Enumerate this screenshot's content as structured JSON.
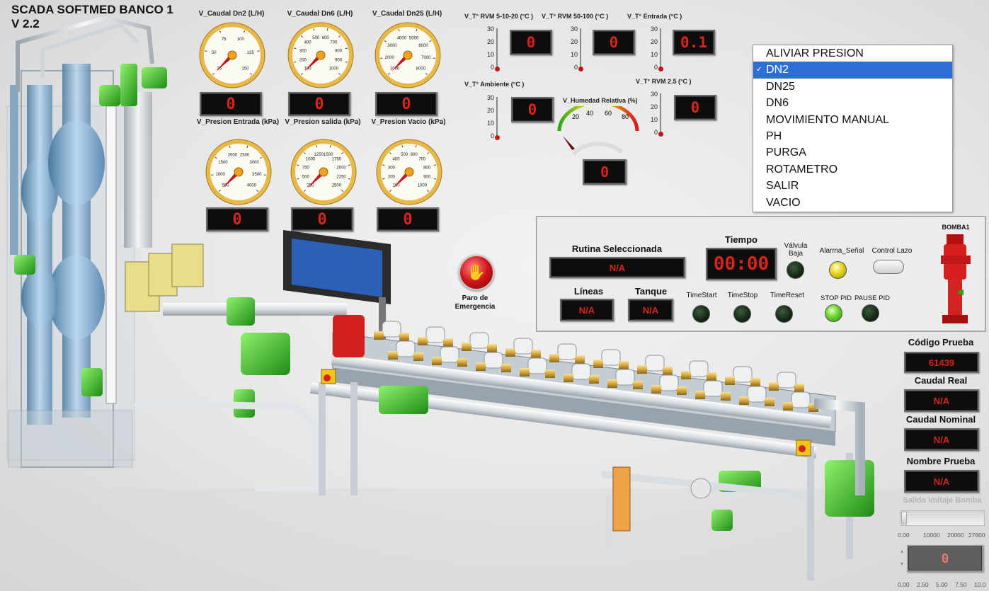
{
  "app": {
    "title_line1": "SCADA SOFTMED BANCO 1",
    "title_line2": "V 2.2"
  },
  "flow_gauges": [
    {
      "label": "V_Caudal Dn2 (L/H)",
      "ticks": [
        "25",
        "50",
        "75",
        "100",
        "125",
        "150"
      ],
      "value": 0,
      "display": "0"
    },
    {
      "label": "V_Caudal Dn6 (L/H)",
      "ticks": [
        "100",
        "200",
        "300",
        "400",
        "500",
        "600",
        "700",
        "800",
        "900",
        "1000"
      ],
      "value": 0,
      "display": "0"
    },
    {
      "label": "V_Caudal Dn25 (L/H)",
      "ticks": [
        "1000",
        "2000",
        "3000",
        "4000",
        "5000",
        "6000",
        "7000",
        "8000"
      ],
      "value": 0,
      "display": "0"
    }
  ],
  "pressure_gauges": [
    {
      "label": "V_Presion Entrada (kPa)",
      "ticks": [
        "500",
        "1000",
        "1500",
        "2000",
        "2500",
        "3000",
        "3500",
        "4000"
      ],
      "value": 0,
      "display": "0"
    },
    {
      "label": "V_Presion salida (kPa)",
      "ticks": [
        "250",
        "500",
        "750",
        "1000",
        "1250",
        "1500",
        "1750",
        "2000",
        "2250",
        "2500"
      ],
      "value": 0,
      "display": "0"
    },
    {
      "label": "V_Presion Vacio (kPa)",
      "ticks": [
        "100",
        "200",
        "300",
        "400",
        "500",
        "600",
        "700",
        "800",
        "900",
        "1000"
      ],
      "value": 0,
      "display": "0"
    }
  ],
  "thermometers": [
    {
      "label": "V_T° RVM 5-10-20 (°C )",
      "scale": [
        "30",
        "20",
        "10",
        "0"
      ],
      "display": "0"
    },
    {
      "label": "V_T° RVM 50-100 (°C )",
      "scale": [
        "30",
        "20",
        "10",
        "0"
      ],
      "display": "0"
    },
    {
      "label": "V_T° Entrada (°C )",
      "scale": [
        "30",
        "20",
        "10",
        "0"
      ],
      "display": "0.1"
    },
    {
      "label": "V_T° Ambiente (°C )",
      "scale": [
        "30",
        "20",
        "10",
        "0"
      ],
      "display": "0"
    },
    {
      "label": "V_T° RVM 2.5 (°C )",
      "scale": [
        "30",
        "20",
        "10",
        "0"
      ],
      "display": "0"
    }
  ],
  "humidity": {
    "label": "V_Humedad Relativa (%)",
    "ticks": [
      "20",
      "40",
      "60",
      "80"
    ],
    "display": "0"
  },
  "routine_menu": {
    "items": [
      "ALIVIAR PRESION",
      "DN2",
      "DN25",
      "DN6",
      "MOVIMIENTO MANUAL",
      "PH",
      "PURGA",
      "ROTAMETRO",
      "SALIR",
      "VACIO"
    ],
    "selected": "DN2"
  },
  "emergency": {
    "label_line1": "Paro de",
    "label_line2": "Emergencia"
  },
  "panel": {
    "rutina_label": "Rutina Seleccionada",
    "rutina_value": "N/A",
    "tiempo_label": "Tiempo",
    "tiempo_value": "00:00",
    "lineas_label": "Líneas",
    "lineas_value": "N/A",
    "tanque_label": "Tanque",
    "tanque_value": "N/A",
    "valvula_label_1": "Válvula",
    "valvula_label_2": "Baja",
    "alarma_label": "Alarma_Señal",
    "control_lazo_label": "Control Lazo",
    "timestart_label": "TimeStart",
    "timestop_label": "TimeStop",
    "timereset_label": "TimeReset",
    "stop_pid_label": "STOP PID",
    "pause_pid_label": "PAUSE PID",
    "bomba_label": "BOMBA1"
  },
  "info": {
    "codigo_label": "Código Prueba",
    "codigo_value": "61439",
    "caudal_real_label": "Caudal Real",
    "caudal_real_value": "N/A",
    "caudal_nominal_label": "Caudal Nominal",
    "caudal_nominal_value": "N/A",
    "nombre_label": "Nombre Prueba",
    "nombre_value": "N/A"
  },
  "voltage": {
    "label": "Salida Voltaje Bomba",
    "scale_top": [
      "0.00",
      "10000",
      "20000",
      "27600"
    ],
    "display": "0",
    "scale_bottom": [
      "0.00",
      "2.50",
      "5.00",
      "7.50",
      "10.0"
    ]
  },
  "colors": {
    "display_text": "#d8251b",
    "gauge_rim": "#e8b848",
    "selection": "#2e6fd6",
    "valve_green": "#3fbf2a"
  }
}
